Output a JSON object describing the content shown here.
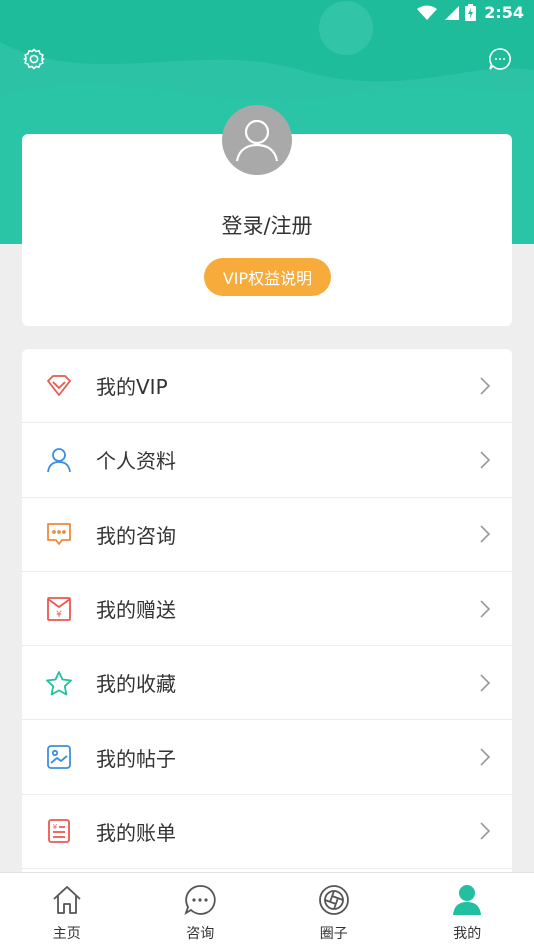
{
  "status_bar": {
    "time": "2:54"
  },
  "profile": {
    "login_label": "登录/注册",
    "vip_button_label": "VIP权益说明"
  },
  "menu": {
    "items": [
      {
        "label": "我的VIP",
        "icon": "diamond-icon",
        "color": "#e85a4f"
      },
      {
        "label": "个人资料",
        "icon": "person-icon",
        "color": "#3d8fe0"
      },
      {
        "label": "我的咨询",
        "icon": "chat-icon",
        "color": "#f08a3c"
      },
      {
        "label": "我的赠送",
        "icon": "gift-envelope-icon",
        "color": "#e85a4f"
      },
      {
        "label": "我的收藏",
        "icon": "star-icon",
        "color": "#22bfa0"
      },
      {
        "label": "我的帖子",
        "icon": "picture-icon",
        "color": "#3d8fe0"
      },
      {
        "label": "我的账单",
        "icon": "bill-icon",
        "color": "#e85a4f"
      }
    ]
  },
  "bottom_nav": {
    "items": [
      {
        "label": "主页",
        "icon": "home-icon"
      },
      {
        "label": "咨询",
        "icon": "chat-bubble-icon"
      },
      {
        "label": "圈子",
        "icon": "aperture-icon"
      },
      {
        "label": "我的",
        "icon": "user-icon",
        "active": true
      }
    ]
  },
  "colors": {
    "accent": "#22bfa0",
    "vip": "#f6ab3a"
  }
}
